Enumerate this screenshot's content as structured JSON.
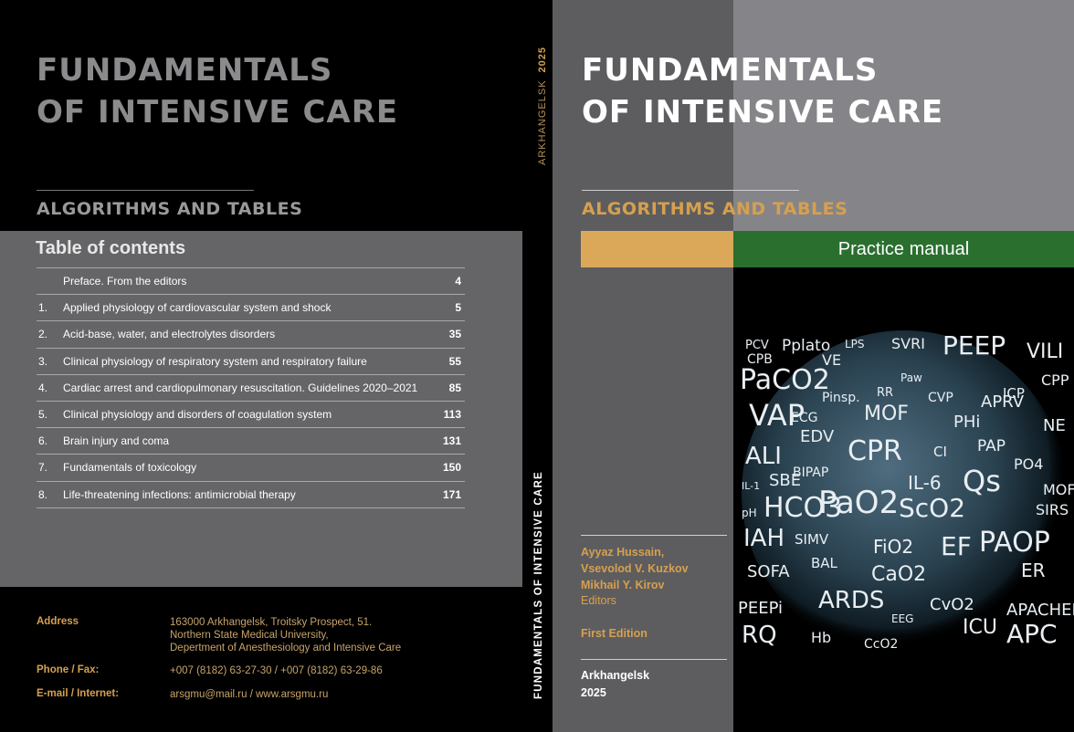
{
  "back_cover": {
    "title_line1": "FUNDAMENTALS",
    "title_line2": "OF INTENSIVE CARE",
    "subtitle": "ALGORITHMS AND TABLES",
    "toc_heading": "Table of contents",
    "toc": [
      {
        "num": "",
        "title": "Preface. From the editors",
        "page": "4"
      },
      {
        "num": "1.",
        "title": "Applied physiology of cardiovascular system and shock",
        "page": "5"
      },
      {
        "num": "2.",
        "title": "Acid-base, water, and electrolytes disorders",
        "page": "35"
      },
      {
        "num": "3.",
        "title": "Clinical physiology of respiratory system and respiratory failure",
        "page": "55"
      },
      {
        "num": "4.",
        "title": "Cardiac arrest and cardiopulmonary resuscitation. Guidelines 2020–2021",
        "page": "85"
      },
      {
        "num": "5.",
        "title": "Clinical physiology and disorders of coagulation system",
        "page": "113"
      },
      {
        "num": "6.",
        "title": "Brain injury and coma",
        "page": "131"
      },
      {
        "num": "7.",
        "title": "Fundamentals of toxicology",
        "page": "150"
      },
      {
        "num": "8.",
        "title": "Life-threatening infections: antimicrobial therapy",
        "page": "171"
      }
    ],
    "contacts": {
      "address_label": "Address",
      "address_lines": [
        "163000 Arkhangelsk, Troitsky Prospect, 51.",
        "Northern State Medical University,",
        "Depertment of Anesthesiology and Intensive Care"
      ],
      "phone_label": "Phone  /  Fax:",
      "phone_value": "+007 (8182) 63-27-30  /  +007 (8182) 63-29-86",
      "email_label": "E-mail / Internet:",
      "email_value": "arsgmu@mail.ru  /  www.arsgmu.ru"
    }
  },
  "spine": {
    "city": "ARKHANGELSK",
    "year": "2025",
    "title": "FUNDAMENTALS OF INTENSIVE CARE"
  },
  "front_cover": {
    "title_line1": "FUNDAMENTALS",
    "title_line2": "OF INTENSIVE CARE",
    "subtitle": "ALGORITHMS AND TABLES",
    "band_label": "Practice manual",
    "authors": [
      "Ayyaz Hussain,",
      "Vsevolod V. Kuzkov",
      "Mikhail Y. Kirov"
    ],
    "editors_label": "Editors",
    "edition": "First Edition",
    "city": "Arkhangelsk",
    "year": "2025"
  },
  "globe_words": [
    "PCV",
    "Pplato",
    "LPS",
    "SVRI",
    "PEEP",
    "VILI",
    "CPB",
    "VE",
    "PaCO2",
    "Paw",
    "CPP",
    "ICP",
    "Pinsp.",
    "RR",
    "CVP",
    "APRV",
    "VAP",
    "MOF",
    "ECG",
    "PHi",
    "NE",
    "EDV",
    "CPR",
    "CI",
    "PAP",
    "PO4",
    "ALI",
    "BIPAP",
    "IL-1",
    "SBE",
    "IL-6",
    "Qs",
    "MOF",
    "pH",
    "HCO3",
    "PaO2",
    "ScO2",
    "SIRS",
    "IAH",
    "SIMV",
    "FiO2",
    "EF",
    "PAOP",
    "BAL",
    "SOFA",
    "CaO2",
    "ER",
    "ARDS",
    "CvO2",
    "PEEPi",
    "EEG",
    "APACHEII",
    "RQ",
    "Hb",
    "CcO2",
    "ICU",
    "APC"
  ],
  "colors": {
    "accent_gold": "#d6a04f",
    "band_green": "#2b6f2f",
    "band_orange": "#dba85a",
    "toc_panel": "#656567"
  }
}
